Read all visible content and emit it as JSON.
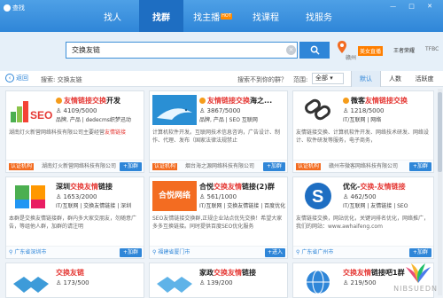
{
  "app": {
    "name": "查找"
  },
  "nav": {
    "tabs": [
      "找人",
      "找群",
      "找主播",
      "找课程",
      "找服务"
    ],
    "hot_badge": "HOT"
  },
  "search": {
    "query": "交换友链",
    "city": "赣州",
    "live": "美女直播",
    "user": "王者荣耀",
    "extra": "TFBC"
  },
  "filter": {
    "back": "返回",
    "scope": "搜索: 交换友链",
    "not_here": "搜索不到你的群？",
    "range_label": "范围:",
    "range_value": "全部",
    "sort": [
      "默认",
      "人数",
      "活跃度"
    ]
  },
  "cards": [
    {
      "thumb_text": "SEO",
      "title_pre": "友情",
      "title_hl": "链接",
      "title_mid": "交换",
      "title_post": "开发",
      "members": "4109/5000",
      "tags": "品牌, 产品  | dedecms织梦迅动",
      "desc": "湖南灯火新营网络科技有限公司主要经营",
      "desc_hl": "友情链接",
      "footer_left": "认证机构",
      "footer_org": "湖南灯火新营网络科技有限公司",
      "button": "+加群",
      "verified": true
    },
    {
      "thumb_text": "",
      "title_pre": "友情",
      "title_hl": "链接",
      "title_mid": "交换",
      "title_post": "海之...",
      "members": "3867/5000",
      "tags": "品牌, 产品  | SEO  互联网",
      "desc": "计算机软件开发。互联网技术信息咨询，广告设计、制作、代理、发布（国家法律法规禁止",
      "desc_hl": "",
      "footer_left": "认证机构",
      "footer_org": "烟台海之源网络科技有限公司",
      "button": "+加群",
      "verified": true
    },
    {
      "thumb_text": "",
      "title_pre": "微客",
      "title_hl": "友情链接",
      "title_mid": "交换",
      "title_post": "",
      "members": "1218/5000",
      "tags": "IT/互联网 | 网络",
      "desc": "友情链接交换、计算机软件开发、网络技术研发、网络设计、软件研发等服务，电子商务，",
      "desc_hl": "",
      "footer_left": "认证机构",
      "footer_org": "赣州市微客网络科技有限公司",
      "button": "+加群",
      "verified": true
    },
    {
      "thumb_text": "",
      "title_pre": "深圳",
      "title_hl": "交换友情",
      "title_mid": "链接",
      "title_post": "",
      "members": "1653/2000",
      "tags": "IT/互联网 | 交换友情链接 | 深圳",
      "desc": "本群是交换友情链接群，群内多大家交朋友，勿随意广告，等组他人群，加群的请注明",
      "desc_hl": "",
      "footer_left": "广东省深圳市",
      "footer_org": "",
      "button": "+加群",
      "verified": false
    },
    {
      "thumb_text": "合悦网络",
      "title_pre": "合悦",
      "title_hl": "交换友情",
      "title_mid": "链接(2)群",
      "title_post": "",
      "members": "561/1000",
      "tags": "IT/互联网 | 交换友情链接 | 百度优化",
      "desc": "SEO友情链接交换群,正规企业站点优先交换！希望大家多多互换链接。同时提供百度SEO优化服务",
      "desc_hl": "",
      "footer_left": "福建省厦门市",
      "footer_org": "",
      "button": "+进入",
      "verified": false
    },
    {
      "thumb_text": "",
      "title_pre": "优化-",
      "title_hl": "交换",
      "title_mid": "-友情",
      "title_post": "链接",
      "members": "462/500",
      "tags": "IT/互联网 | 友情链接 | SEO",
      "desc": "友情链接交换，网站优化，关键词排名优化，网络推广，我们的网站：www.awhaifeng.com",
      "desc_hl": "",
      "footer_left": "广东省广州市",
      "footer_org": "",
      "button": "+加群",
      "verified": false
    },
    {
      "thumb_text": "",
      "title_pre": "交换",
      "title_hl": "友链",
      "title_mid": "",
      "title_post": "",
      "members": "173/500",
      "tags": "",
      "desc": "",
      "desc_hl": "",
      "footer_left": "",
      "footer_org": "",
      "button": "",
      "verified": false
    },
    {
      "thumb_text": "",
      "title_pre": "家政",
      "title_hl": "交换友情",
      "title_mid": "链接",
      "title_post": "",
      "members": "139/200",
      "tags": "",
      "desc": "",
      "desc_hl": "",
      "footer_left": "",
      "footer_org": "",
      "button": "",
      "verified": false
    },
    {
      "thumb_text": "",
      "title_pre": "",
      "title_hl": "交换友情",
      "title_mid": "链接吧1群",
      "title_post": "",
      "members": "219/500",
      "tags": "",
      "desc": "",
      "desc_hl": "",
      "footer_left": "",
      "footer_org": "",
      "button": "",
      "verified": false
    }
  ],
  "watermark": "NIBSUEDN",
  "colors": {
    "accent": "#2f86d8",
    "highlight": "#e53935",
    "cert": "#f36c21"
  }
}
